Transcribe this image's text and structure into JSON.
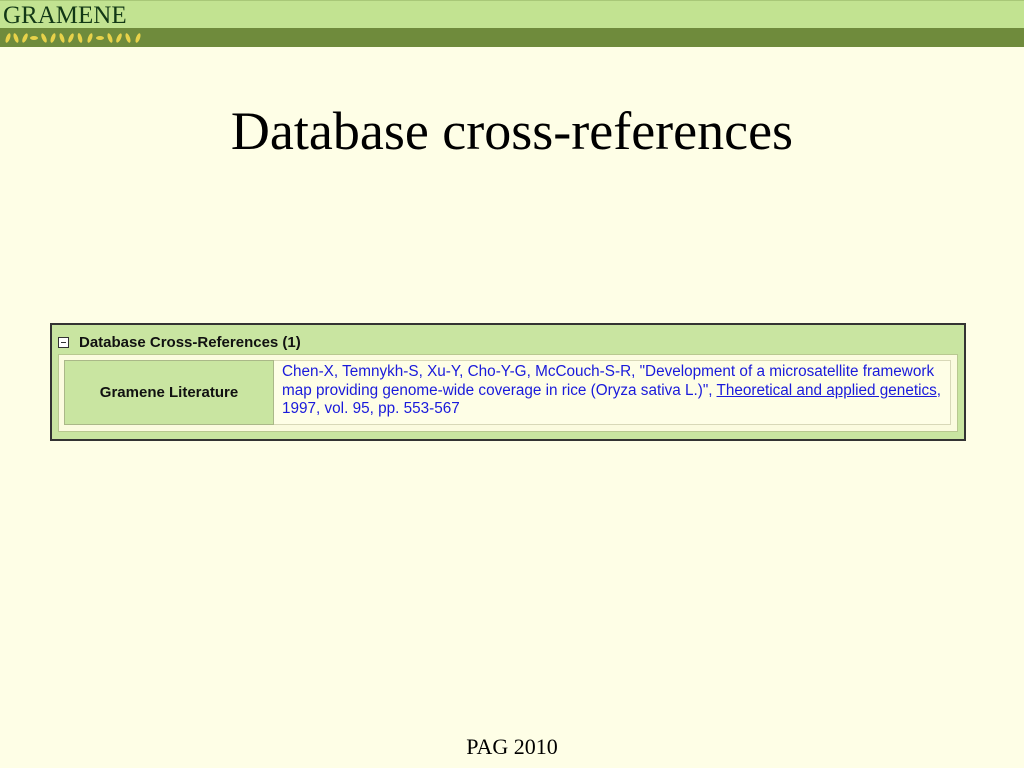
{
  "header": {
    "logo_text": "GRAMENE"
  },
  "slide": {
    "title": "Database cross-references",
    "footer": "PAG 2010"
  },
  "panel": {
    "heading": "Database Cross-References (1)",
    "rows": [
      {
        "label": "Gramene Literature",
        "citation_text": "Chen-X, Temnykh-S, Xu-Y, Cho-Y-G, McCouch-S-R, \"Development of a microsatellite framework map providing genome-wide coverage in rice (Oryza sativa L.)\", ",
        "journal_link": "Theoretical and applied genetics",
        "citation_tail": ", 1997, vol. 95, pp. 553-567"
      }
    ]
  },
  "colors": {
    "header_light": "#c2e391",
    "header_dark": "#6f8b3c",
    "panel_bg": "#c9e5a1",
    "link": "#1a1adb",
    "page_bg": "#fefee6"
  }
}
